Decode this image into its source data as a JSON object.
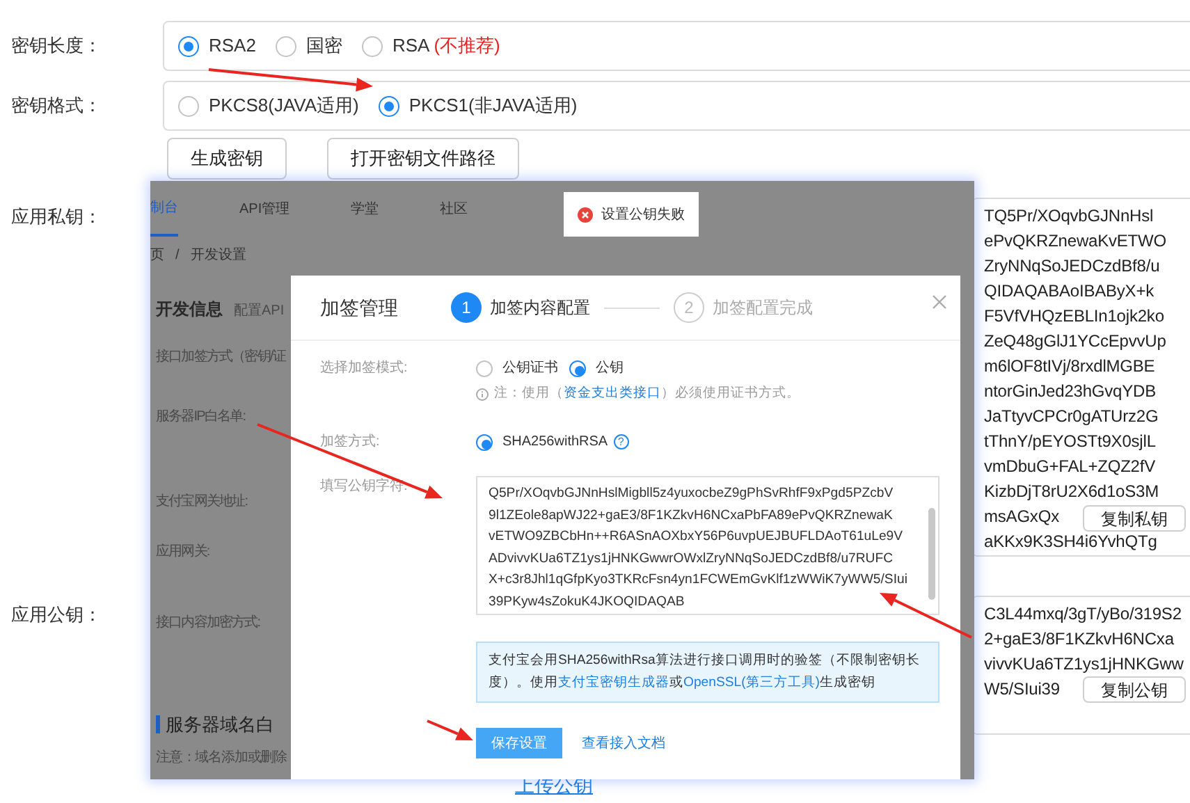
{
  "settings": {
    "key_length": {
      "label": "密钥长度：",
      "options": [
        {
          "label": "RSA2",
          "selected": true
        },
        {
          "label": "国密",
          "selected": false
        },
        {
          "label": "RSA",
          "note": "(不推荐)",
          "selected": false
        }
      ]
    },
    "key_format": {
      "label": "密钥格式：",
      "options": [
        {
          "label": "PKCS8(JAVA适用)",
          "selected": false
        },
        {
          "label": "PKCS1(非JAVA适用)",
          "selected": true
        }
      ]
    },
    "buttons": [
      "生成密钥",
      "打开密钥文件路径"
    ],
    "private_key": {
      "label": "应用私钥：",
      "lines": [
        "TQ5Pr/XOqvbGJNnHsl",
        "ePvQKRZnewaKvETWO",
        "ZryNNqSoJEDCzdBf8/u",
        "QIDAQABAoIBAByX+k",
        "F5VfVHQzEBLIn1ojk2ko",
        "ZeQ48gGlJ1YCcEpvvUp",
        "m6lOF8tIVj/8rxdlMGBE",
        "ntorGinJed23hGvqYDB",
        "JaTtyvCPCr0gATUrz2G",
        "tThnY/pEYOSTt9X0sjlL",
        "vmDbuG+FAL+ZQZ2fV",
        "KizbDjT8rU2X6d1oS3M",
        "msAGxQx",
        "aKKx9K3SH4i6YvhQTg"
      ],
      "copy_button": "复制私钥"
    },
    "public_key": {
      "label": "应用公钥：",
      "lines": [
        "C3L44mxq/3gT/yBo/319S2",
        "2+gaE3/8F1KZkvH6NCxa",
        "vivvKUa6TZ1ys1jHNKGww",
        "W5/SIui39"
      ],
      "copy_button": "复制公钥"
    },
    "upload_link": "上传公钥"
  },
  "embedded_screenshot": {
    "nav": [
      {
        "label": "制台",
        "selected": true
      },
      {
        "label": "API管理",
        "selected": false
      },
      {
        "label": "学堂",
        "selected": false
      },
      {
        "label": "社区",
        "selected": false
      }
    ],
    "breadcrumb": [
      "页",
      "开发设置"
    ],
    "breadcrumb_separator": "/",
    "page_title": "开发信息",
    "page_subtitle": "配置API",
    "fields": [
      "接口加签方式（密钥/证",
      "服务器IP白名单:",
      "支付宝网关地址:",
      "应用网关:",
      "接口内容加密方式:"
    ],
    "section_title": "服务器域名白",
    "section_note": "注意：域名添加或删除",
    "toast": "设置公钥失败",
    "modal": {
      "title": "加签管理",
      "steps": [
        {
          "number": "1",
          "label": "加签内容配置",
          "active": true
        },
        {
          "number": "2",
          "label": "加签配置完成",
          "active": false
        }
      ],
      "sign_mode": {
        "label": "选择加签模式:",
        "options": [
          {
            "label": "公钥证书",
            "selected": false
          },
          {
            "label": "公钥",
            "selected": true
          }
        ]
      },
      "note": {
        "prefix": "注：使用（",
        "link": "资金支出类接口",
        "suffix": "）必须使用证书方式。"
      },
      "sign_method": {
        "label": "加签方式:",
        "options": [
          {
            "label": "SHA256withRSA",
            "selected": true
          }
        ],
        "help_mark": "?"
      },
      "public_key": {
        "label": "填写公钥字符:",
        "lines": [
          "Q5Pr/XOqvbGJNnHslMigbll5z4yuxocbeZ9gPhSvRhfF9xPgd5PZcbV",
          "9l1ZEole8apWJ22+gaE3/8F1KZkvH6NCxaPbFA89ePvQKRZnewaK",
          "vETWO9ZBCbHn++R6ASnAOXbxY56P6uvpUEJBUFLDAoT61uLe9V",
          "ADvivvKUa6TZ1ys1jHNKGwwrOWxlZryNNqSoJEDCzdBf8/u7RUFC",
          "X+c3r8Jhl1qGfpKyo3TKRcFsn4yn1FCWEmGvKlf1zWWiK7yWW5/SIui",
          "39PKyw4sZokuK4JKOQIDAQAB"
        ]
      },
      "info": {
        "text": "支付宝会用SHA256withRsa算法进行接口调用时的验签（不限制密钥长度）。使用",
        "link1": "支付宝密钥生成器",
        "middle": "或",
        "link2": "OpenSSL(第三方工具)",
        "suffix": "生成密钥"
      },
      "save_button": "保存设置",
      "docs_link": "查看接入文档"
    }
  }
}
